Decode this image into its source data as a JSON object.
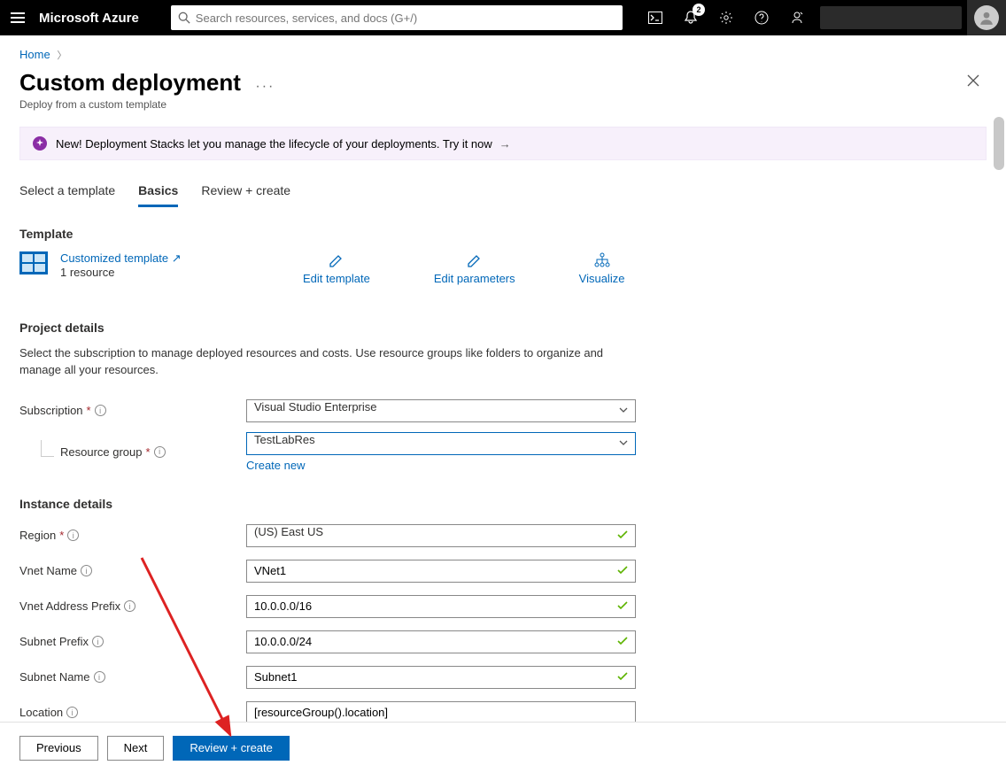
{
  "topbar": {
    "brand": "Microsoft Azure",
    "search_placeholder": "Search resources, services, and docs (G+/)",
    "notification_count": "2"
  },
  "breadcrumb": {
    "home": "Home"
  },
  "page": {
    "title": "Custom deployment",
    "subtitle": "Deploy from a custom template"
  },
  "banner": {
    "text": "New! Deployment Stacks let you manage the lifecycle of your deployments. Try it now"
  },
  "tabs": {
    "t0": "Select a template",
    "t1": "Basics",
    "t2": "Review + create"
  },
  "template_section": {
    "heading": "Template",
    "link": "Customized template",
    "res_count": "1 resource",
    "edit_template": "Edit template",
    "edit_parameters": "Edit parameters",
    "visualize": "Visualize"
  },
  "project": {
    "heading": "Project details",
    "help": "Select the subscription to manage deployed resources and costs. Use resource groups like folders to organize and manage all your resources.",
    "subscription_label": "Subscription",
    "subscription_value": "Visual Studio Enterprise",
    "rg_label": "Resource group",
    "rg_value": "TestLabRes",
    "create_new": "Create new"
  },
  "instance": {
    "heading": "Instance details",
    "region_label": "Region",
    "region_value": "(US) East US",
    "vnet_name_label": "Vnet Name",
    "vnet_name_value": "VNet1",
    "vnet_prefix_label": "Vnet Address Prefix",
    "vnet_prefix_value": "10.0.0.0/16",
    "subnet_prefix_label": "Subnet Prefix",
    "subnet_prefix_value": "10.0.0.0/24",
    "subnet_name_label": "Subnet Name",
    "subnet_name_value": "Subnet1",
    "location_label": "Location",
    "location_value": "[resourceGroup().location]"
  },
  "footer": {
    "previous": "Previous",
    "next": "Next",
    "review": "Review + create"
  }
}
